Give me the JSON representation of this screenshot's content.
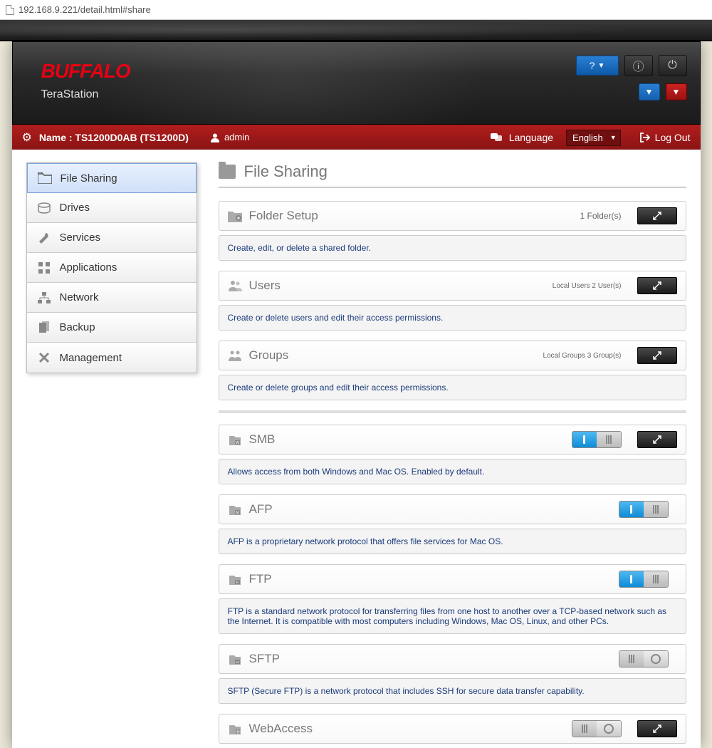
{
  "address_bar": {
    "url": "192.168.9.221/detail.html#share"
  },
  "header": {
    "brand": "BUFFALO",
    "product": "TeraStation",
    "help_label": "?"
  },
  "status_bar": {
    "name_label": "Name :",
    "device_name": "TS1200D0AB (TS1200D)",
    "user": "admin",
    "language_label": "Language",
    "language_value": "English",
    "logout": "Log Out"
  },
  "sidebar": {
    "items": [
      {
        "label": "File Sharing",
        "icon": "folder"
      },
      {
        "label": "Drives",
        "icon": "drive"
      },
      {
        "label": "Services",
        "icon": "wrench"
      },
      {
        "label": "Applications",
        "icon": "apps"
      },
      {
        "label": "Network",
        "icon": "network"
      },
      {
        "label": "Backup",
        "icon": "backup"
      },
      {
        "label": "Management",
        "icon": "tools"
      }
    ]
  },
  "section": {
    "title": "File Sharing"
  },
  "cards": {
    "folder_setup": {
      "title": "Folder Setup",
      "meta": "1 Folder(s)",
      "desc": "Create, edit, or delete a shared folder."
    },
    "users": {
      "title": "Users",
      "meta": "Local Users 2 User(s)",
      "desc": "Create or delete users and edit their access permissions."
    },
    "groups": {
      "title": "Groups",
      "meta": "Local Groups 3 Group(s)",
      "desc": "Create or delete groups and edit their access permissions."
    },
    "smb": {
      "title": "SMB",
      "desc": "Allows access from both Windows and Mac OS. Enabled by default.",
      "toggle": true
    },
    "afp": {
      "title": "AFP",
      "desc": "AFP is a proprietary network protocol that offers file services for Mac OS.",
      "toggle": true
    },
    "ftp": {
      "title": "FTP",
      "desc": "FTP is a standard network protocol for transferring files from one host to another over a TCP-based network such as the Internet. It is compatible with most computers including Windows, Mac OS, Linux, and other PCs.",
      "toggle": true
    },
    "sftp": {
      "title": "SFTP",
      "desc": "SFTP (Secure FTP) is a network protocol that includes SSH for secure data transfer capability.",
      "toggle": false
    },
    "webaccess": {
      "title": "WebAccess",
      "toggle": false
    }
  }
}
